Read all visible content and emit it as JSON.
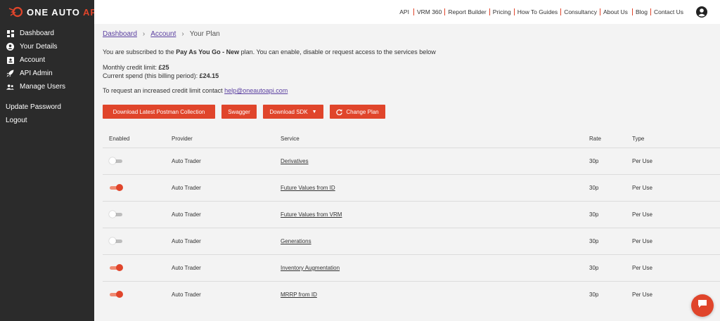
{
  "brand": {
    "name_main": "ONE AUTO",
    "name_accent": "API"
  },
  "sidebar": {
    "items": [
      {
        "label": "Dashboard",
        "icon": "dashboard-icon"
      },
      {
        "label": "Your Details",
        "icon": "user-circle-icon"
      },
      {
        "label": "Account",
        "icon": "id-card-icon"
      },
      {
        "label": "API Admin",
        "icon": "rocket-icon"
      },
      {
        "label": "Manage Users",
        "icon": "users-icon"
      }
    ],
    "secondary": [
      {
        "label": "Update Password"
      },
      {
        "label": "Logout"
      }
    ]
  },
  "topnav": {
    "items": [
      "API",
      "VRM 360",
      "Report Builder",
      "Pricing",
      "How To Guides",
      "Consultancy",
      "About Us",
      "Blog",
      "Contact Us"
    ]
  },
  "breadcrumb": {
    "dashboard": "Dashboard",
    "account": "Account",
    "current": "Your Plan",
    "separator": "›"
  },
  "plan": {
    "intro_before": "You are subscribed to the ",
    "plan_name": "Pay As You Go - New",
    "intro_after": " plan. You can enable, disable or request access to the services below",
    "credit_limit_label": "Monthly credit limit: ",
    "credit_limit_value": "£25",
    "spend_label": "Current spend (this billing period): ",
    "spend_value": "£24.15",
    "contact_text": "To request an increased credit limit contact ",
    "contact_email": "help@oneautoapi.com"
  },
  "buttons": {
    "postman": "Download Latest Postman Collection",
    "swagger": "Swagger",
    "sdk": "Download SDK",
    "change_plan": "Change Plan"
  },
  "table": {
    "headers": {
      "enabled": "Enabled",
      "provider": "Provider",
      "service": "Service",
      "rate": "Rate",
      "type": "Type"
    },
    "rows": [
      {
        "enabled": false,
        "provider": "Auto Trader",
        "service": "Derivatives",
        "rate": "30p",
        "type": "Per Use"
      },
      {
        "enabled": true,
        "provider": "Auto Trader",
        "service": "Future Values from ID",
        "rate": "30p",
        "type": "Per Use"
      },
      {
        "enabled": false,
        "provider": "Auto Trader",
        "service": "Future Values from VRM",
        "rate": "30p",
        "type": "Per Use"
      },
      {
        "enabled": false,
        "provider": "Auto Trader",
        "service": "Generations",
        "rate": "30p",
        "type": "Per Use"
      },
      {
        "enabled": true,
        "provider": "Auto Trader",
        "service": "Inventory Augmentation",
        "rate": "30p",
        "type": "Per Use"
      },
      {
        "enabled": true,
        "provider": "Auto Trader",
        "service": "MRRP from ID",
        "rate": "30p",
        "type": "Per Use"
      }
    ]
  },
  "colors": {
    "accent": "#e0452b",
    "sidebar_bg": "#2b2b2b",
    "link": "#5a3fa0",
    "page_bg": "#f3f3f3"
  }
}
